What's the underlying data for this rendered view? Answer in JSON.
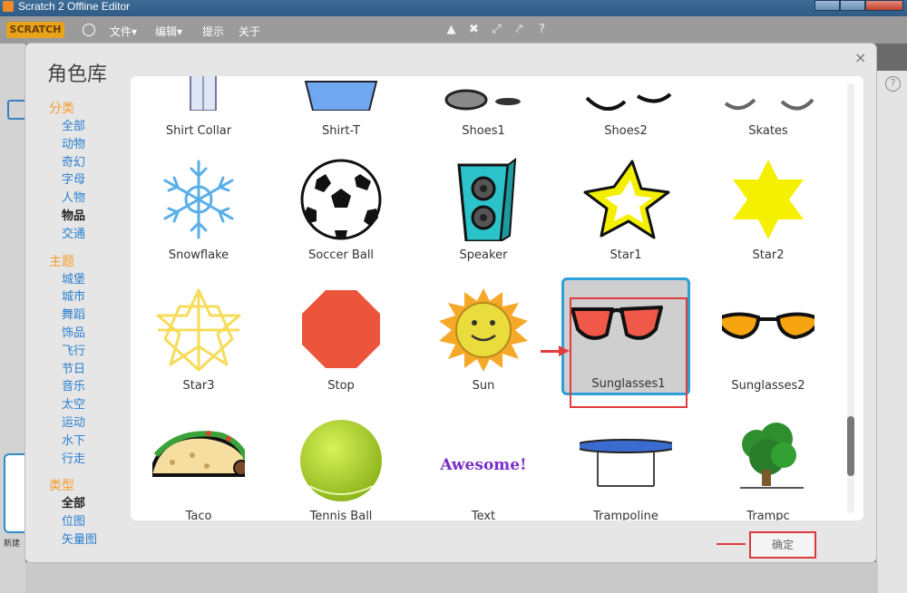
{
  "window": {
    "title": "Scratch 2 Offline Editor"
  },
  "menubar": {
    "logo": "SCRATCH",
    "items": [
      "文件▾",
      "编辑▾",
      "提示",
      "关于"
    ]
  },
  "dialog": {
    "title": "角色库",
    "close": "×",
    "confirm_label": "确定"
  },
  "sidebar": {
    "groups": [
      {
        "header": "分类",
        "items": [
          "全部",
          "动物",
          "奇幻",
          "字母",
          "人物",
          "物品",
          "交通"
        ],
        "selected": "物品"
      },
      {
        "header": "主题",
        "items": [
          "城堡",
          "城市",
          "舞蹈",
          "饰品",
          "飞行",
          "节日",
          "音乐",
          "太空",
          "运动",
          "水下",
          "行走"
        ]
      },
      {
        "header": "类型",
        "items": [
          "全部",
          "位图",
          "矢量图"
        ],
        "selected": "全部"
      }
    ]
  },
  "sprites": {
    "row1": [
      "Shirt Collar",
      "Shirt-T",
      "Shoes1",
      "Shoes2",
      "Skates"
    ],
    "row2": [
      "Snowflake",
      "Soccer Ball",
      "Speaker",
      "Star1",
      "Star2"
    ],
    "row3": [
      "Star3",
      "Stop",
      "Sun",
      "Sunglasses1",
      "Sunglasses2"
    ],
    "row4": [
      "Taco",
      "Tennis Ball",
      "Text",
      "Trampoline",
      "Trampc"
    ],
    "text_sprite_word": "Awesome!",
    "selected": "Sunglasses1"
  },
  "bg": {
    "new_label": "新建"
  },
  "colors": {
    "accent": "#2e9fd8",
    "group_header": "#f59b2b",
    "link": "#2a7fcf",
    "annotation": "#e23b3b"
  }
}
